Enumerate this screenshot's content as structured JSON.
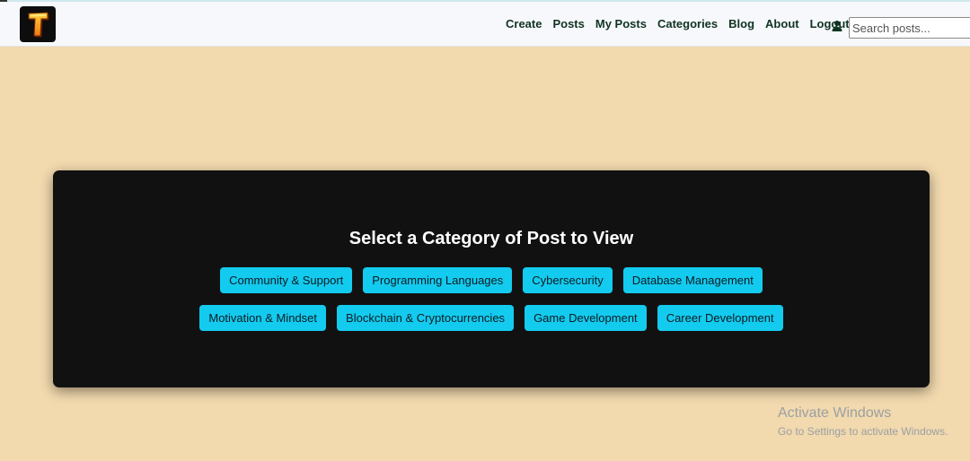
{
  "navbar": {
    "logo_letter": "T",
    "links": [
      "Create",
      "Posts",
      "My Posts",
      "Categories",
      "Blog",
      "About",
      "Logout"
    ],
    "user_icon": "user-icon",
    "search_placeholder": "Search posts..."
  },
  "panel": {
    "title": "Select a Category of Post to View",
    "row1": [
      "Community & Support",
      "Programming Languages",
      "Cybersecurity",
      "Database Management"
    ],
    "row2": [
      "Motivation & Mindset",
      "Blockchain & Cryptocurrencies",
      "Game Development",
      "Career Development"
    ]
  },
  "watermark": {
    "title": "Activate Windows",
    "subtitle": "Go to Settings to activate Windows."
  },
  "colors": {
    "page_bg": "#f2d9ae",
    "navbar_bg": "#f6f8fb",
    "nav_text": "#103322",
    "panel_bg": "#111111",
    "category_button": "#13cbef"
  }
}
